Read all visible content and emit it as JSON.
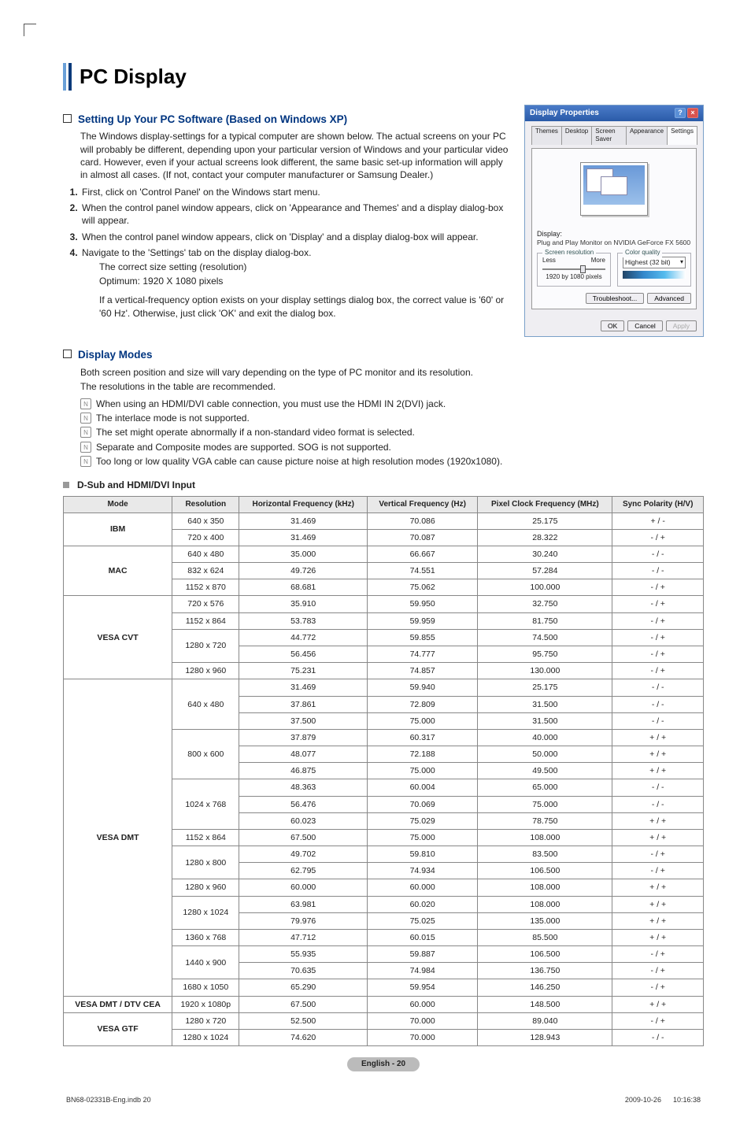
{
  "title": "PC Display",
  "section1": {
    "heading": "Setting Up Your PC Software (Based on Windows XP)",
    "intro": "The Windows display-settings for a typical computer are shown below. The actual screens on your PC will probably be different, depending upon your particular version of Windows and your particular video card. However, even if your actual screens look different, the same basic set-up information will apply in almost all cases. (If not, contact your computer manufacturer or Samsung Dealer.)",
    "steps": [
      "First, click on 'Control Panel' on the Windows start menu.",
      "When the control panel window appears, click on 'Appearance and Themes' and a display dialog-box will appear.",
      "When the control panel window appears, click on 'Display' and a display dialog-box will appear.",
      "Navigate to the 'Settings' tab on the display dialog-box."
    ],
    "sub1": "The correct size setting (resolution)",
    "sub2": "Optimum: 1920 X 1080 pixels",
    "sub3": "If a vertical-frequency option exists on your display settings dialog box, the correct value is '60' or '60 Hz'. Otherwise, just click 'OK' and exit the dialog box."
  },
  "dialog": {
    "title": "Display Properties",
    "tabs": [
      "Themes",
      "Desktop",
      "Screen Saver",
      "Appearance",
      "Settings"
    ],
    "display_label": "Display:",
    "display_value": "Plug and Play Monitor on NVIDIA GeForce FX 5600",
    "sr_legend": "Screen resolution",
    "sr_less": "Less",
    "sr_more": "More",
    "sr_value": "1920 by 1080 pixels",
    "cq_legend": "Color quality",
    "cq_value": "Highest (32 bit)",
    "btn_troubleshoot": "Troubleshoot...",
    "btn_advanced": "Advanced",
    "btn_ok": "OK",
    "btn_cancel": "Cancel",
    "btn_apply": "Apply"
  },
  "section2": {
    "heading": "Display Modes",
    "p1": "Both screen position and size will vary depending on the type of PC monitor and its resolution.",
    "p2": "The resolutions in the table are recommended.",
    "notes": [
      "When using an HDMI/DVI cable connection, you must use the HDMI IN 2(DVI) jack.",
      "The interlace mode is not supported.",
      "The set might operate abnormally if a non-standard video format is selected.",
      "Separate and Composite modes are supported. SOG is not supported.",
      "Too long or low quality VGA cable can cause picture noise at high resolution modes (1920x1080)."
    ]
  },
  "input_heading": "D-Sub and HDMI/DVI Input",
  "table": {
    "headers": [
      "Mode",
      "Resolution",
      "Horizontal Frequency (kHz)",
      "Vertical Frequency (Hz)",
      "Pixel Clock Frequency (MHz)",
      "Sync Polarity (H/V)"
    ],
    "groups": [
      {
        "mode": "IBM",
        "rows": [
          {
            "res": "640 x 350",
            "hf": "31.469",
            "vf": "70.086",
            "pc": "25.175",
            "sp": "+ / -"
          },
          {
            "res": "720 x 400",
            "hf": "31.469",
            "vf": "70.087",
            "pc": "28.322",
            "sp": "- / +"
          }
        ]
      },
      {
        "mode": "MAC",
        "rows": [
          {
            "res": "640 x 480",
            "hf": "35.000",
            "vf": "66.667",
            "pc": "30.240",
            "sp": "- / -"
          },
          {
            "res": "832 x 624",
            "hf": "49.726",
            "vf": "74.551",
            "pc": "57.284",
            "sp": "- / -"
          },
          {
            "res": "1152 x 870",
            "hf": "68.681",
            "vf": "75.062",
            "pc": "100.000",
            "sp": "- / +"
          }
        ]
      },
      {
        "mode": "VESA CVT",
        "rows": [
          {
            "res": "720 x 576",
            "hf": "35.910",
            "vf": "59.950",
            "pc": "32.750",
            "sp": "- / +"
          },
          {
            "res": "1152 x 864",
            "hf": "53.783",
            "vf": "59.959",
            "pc": "81.750",
            "sp": "- / +"
          },
          {
            "res": "1280 x 720",
            "span": 2,
            "hf": "44.772",
            "vf": "59.855",
            "pc": "74.500",
            "sp": "- / +"
          },
          {
            "hf": "56.456",
            "vf": "74.777",
            "pc": "95.750",
            "sp": "- / +"
          },
          {
            "res": "1280 x 960",
            "hf": "75.231",
            "vf": "74.857",
            "pc": "130.000",
            "sp": "- / +"
          }
        ]
      },
      {
        "mode": "VESA DMT",
        "rows": [
          {
            "res": "640 x 480",
            "span": 3,
            "hf": "31.469",
            "vf": "59.940",
            "pc": "25.175",
            "sp": "- / -"
          },
          {
            "hf": "37.861",
            "vf": "72.809",
            "pc": "31.500",
            "sp": "- / -"
          },
          {
            "hf": "37.500",
            "vf": "75.000",
            "pc": "31.500",
            "sp": "- / -"
          },
          {
            "res": "800 x 600",
            "span": 3,
            "hf": "37.879",
            "vf": "60.317",
            "pc": "40.000",
            "sp": "+ / +"
          },
          {
            "hf": "48.077",
            "vf": "72.188",
            "pc": "50.000",
            "sp": "+ / +"
          },
          {
            "hf": "46.875",
            "vf": "75.000",
            "pc": "49.500",
            "sp": "+ / +"
          },
          {
            "res": "1024 x 768",
            "span": 3,
            "hf": "48.363",
            "vf": "60.004",
            "pc": "65.000",
            "sp": "- / -"
          },
          {
            "hf": "56.476",
            "vf": "70.069",
            "pc": "75.000",
            "sp": "- / -"
          },
          {
            "hf": "60.023",
            "vf": "75.029",
            "pc": "78.750",
            "sp": "+ / +"
          },
          {
            "res": "1152 x 864",
            "hf": "67.500",
            "vf": "75.000",
            "pc": "108.000",
            "sp": "+ / +"
          },
          {
            "res": "1280 x 800",
            "span": 2,
            "hf": "49.702",
            "vf": "59.810",
            "pc": "83.500",
            "sp": "- / +"
          },
          {
            "hf": "62.795",
            "vf": "74.934",
            "pc": "106.500",
            "sp": "- / +"
          },
          {
            "res": "1280 x 960",
            "hf": "60.000",
            "vf": "60.000",
            "pc": "108.000",
            "sp": "+ / +"
          },
          {
            "res": "1280 x 1024",
            "span": 2,
            "hf": "63.981",
            "vf": "60.020",
            "pc": "108.000",
            "sp": "+ / +"
          },
          {
            "hf": "79.976",
            "vf": "75.025",
            "pc": "135.000",
            "sp": "+ / +"
          },
          {
            "res": "1360 x 768",
            "hf": "47.712",
            "vf": "60.015",
            "pc": "85.500",
            "sp": "+ / +"
          },
          {
            "res": "1440 x 900",
            "span": 2,
            "hf": "55.935",
            "vf": "59.887",
            "pc": "106.500",
            "sp": "- / +"
          },
          {
            "hf": "70.635",
            "vf": "74.984",
            "pc": "136.750",
            "sp": "- / +"
          },
          {
            "res": "1680 x 1050",
            "hf": "65.290",
            "vf": "59.954",
            "pc": "146.250",
            "sp": "- / +"
          }
        ]
      },
      {
        "mode": "VESA DMT / DTV CEA",
        "rows": [
          {
            "res": "1920 x 1080p",
            "hf": "67.500",
            "vf": "60.000",
            "pc": "148.500",
            "sp": "+ / +"
          }
        ]
      },
      {
        "mode": "VESA GTF",
        "rows": [
          {
            "res": "1280 x 720",
            "hf": "52.500",
            "vf": "70.000",
            "pc": "89.040",
            "sp": "- / +"
          },
          {
            "res": "1280 x 1024",
            "hf": "74.620",
            "vf": "70.000",
            "pc": "128.943",
            "sp": "- / -"
          }
        ]
      }
    ]
  },
  "footer_pill": "English - 20",
  "bottom_left": "BN68-02331B-Eng.indb   20",
  "bottom_right": "2009-10-26      10:16:38"
}
